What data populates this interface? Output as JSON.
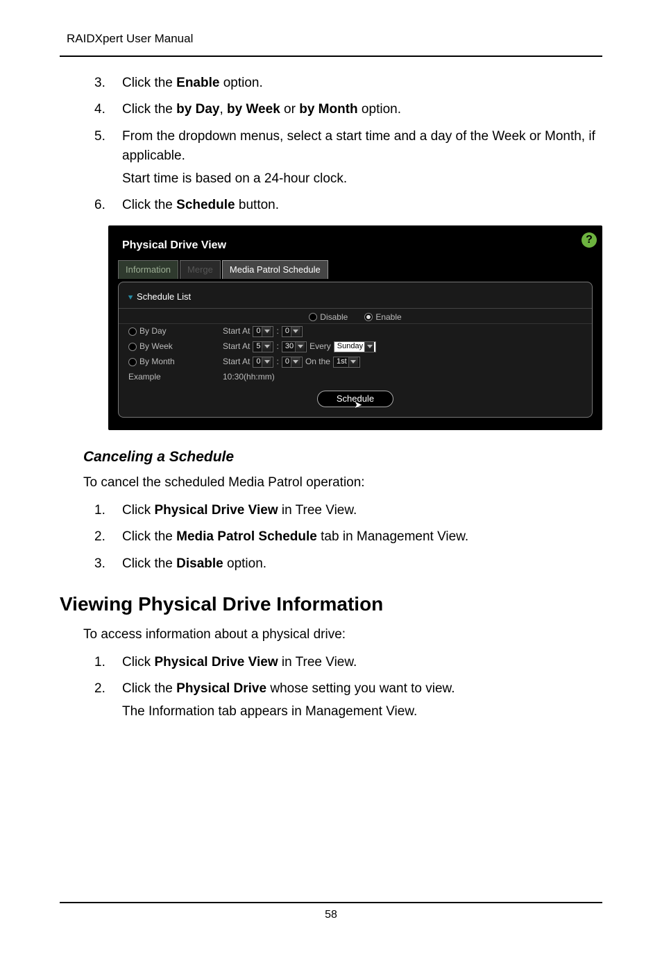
{
  "doc_title": "RAIDXpert User Manual",
  "steps_a": [
    {
      "num": "3",
      "pre": "Click the ",
      "bold": "Enable",
      "post": " option."
    },
    {
      "num": "4",
      "text": "step4"
    },
    {
      "num": "5",
      "pre": "From the dropdown menus, select a start time and a day of the Week or Month, if applicable.",
      "sub": "Start time is based on a 24-hour clock."
    },
    {
      "num": "6",
      "pre": "Click the ",
      "bold": "Schedule",
      "post": " button."
    }
  ],
  "step4": {
    "a": "Click the ",
    "b": "by Day",
    "c": ", ",
    "d": "by Week",
    "e": " or ",
    "f": "by Month",
    "g": " option."
  },
  "panel": {
    "title": "Physical Drive View",
    "help": "?",
    "tabs": {
      "info": "Information",
      "merge": "Merge",
      "mps": "Media Patrol Schedule"
    },
    "list_head": "Schedule List",
    "disable": "Disable",
    "enable": "Enable",
    "byday": "By Day",
    "byweek": "By Week",
    "bymonth": "By Month",
    "startat": "Start At",
    "every": "Every",
    "onthe": "On the",
    "sunday": "Sunday",
    "first": "1st",
    "example_lbl": "Example",
    "example_val": "10:30(hh:mm)",
    "vals": {
      "h0": "0",
      "m0": "0",
      "h5": "5",
      "m30": "30"
    },
    "btn": "Schedule"
  },
  "cancel_heading": "Canceling a Schedule",
  "cancel_intro": "To cancel the scheduled Media Patrol operation:",
  "cancel_steps": [
    {
      "num": "1",
      "pre": "Click ",
      "bold": "Physical Drive View",
      "post": " in Tree View."
    },
    {
      "num": "2",
      "pre": "Click the ",
      "bold": "Media Patrol Schedule",
      "post": " tab in Management View."
    },
    {
      "num": "3",
      "pre": "Click the ",
      "bold": "Disable",
      "post": " option."
    }
  ],
  "view_heading": "Viewing Physical Drive Information",
  "view_intro": "To access information about a physical drive:",
  "view_steps": [
    {
      "num": "1",
      "pre": "Click ",
      "bold": "Physical Drive View",
      "post": " in Tree View."
    },
    {
      "num": "2",
      "pre": "Click the ",
      "bold": "Physical Drive",
      "post": " whose setting you want to view.",
      "sub": "The Information tab appears in Management View."
    }
  ],
  "page_number": "58"
}
